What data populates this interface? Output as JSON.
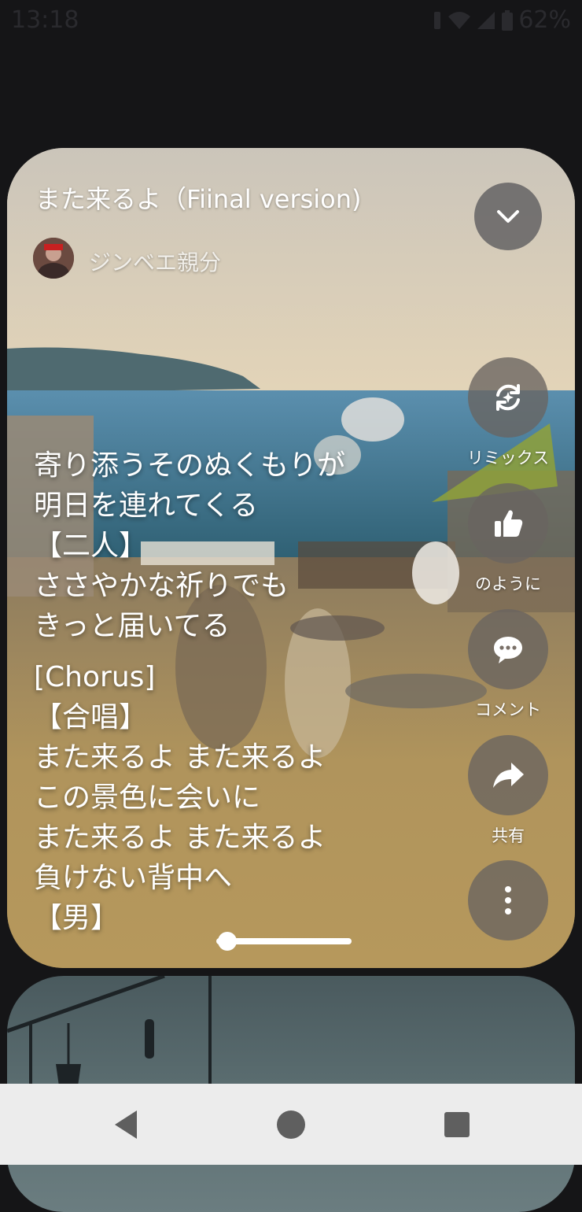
{
  "status_bar": {
    "time": "13:18",
    "battery": "62%"
  },
  "song": {
    "title": "また来るよ（Fiinal version)",
    "artist": "ジンベエ親分"
  },
  "lyrics": [
    "寄り添うそのぬくもりが",
    "明日を連れてくる",
    "【二人】",
    "ささやかな祈りでも",
    "きっと届いてる",
    "",
    "[Chorus]",
    "【合唱】",
    "また来るよ また来るよ",
    "この景色に会いに",
    "また来るよ また来るよ",
    "負けない背中へ",
    "【男】"
  ],
  "actions": {
    "remix": "リミックス",
    "like": "のように",
    "comment": "コメント",
    "share": "共有"
  },
  "playback": {
    "progress": 0.08
  },
  "icons": {
    "collapse": "chevron-down-icon",
    "remix": "remix-sparkle-icon",
    "like": "thumbs-up-icon",
    "comment": "comment-bubble-icon",
    "share": "share-arrow-icon",
    "more": "more-vertical-icon",
    "nav_back": "back-triangle-icon",
    "nav_home": "home-circle-icon",
    "nav_recents": "recents-square-icon"
  }
}
